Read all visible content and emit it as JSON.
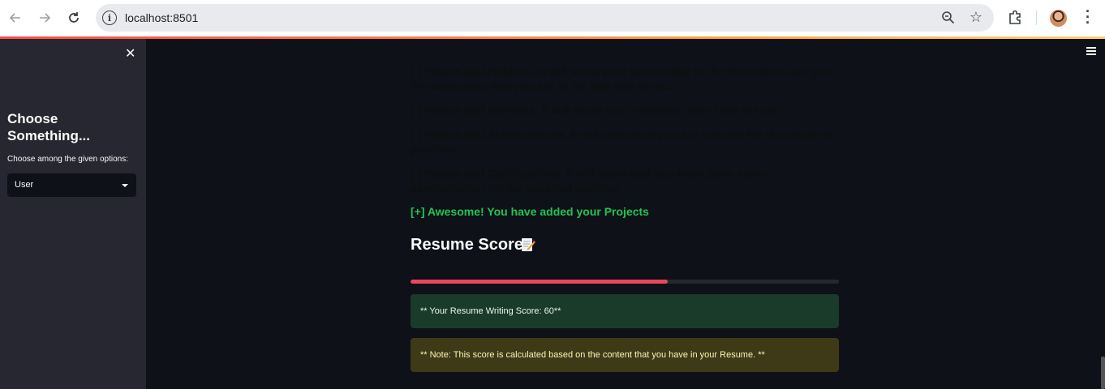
{
  "browser": {
    "url": "localhost:8501",
    "icons": [
      "back-icon",
      "forward-icon",
      "reload-icon",
      "info-icon",
      "zoom-icon",
      "star-icon",
      "extensions-icon",
      "profile-avatar",
      "menu-icon"
    ]
  },
  "sidebar": {
    "title": "Choose Something...",
    "select_label": "Choose among the given options:",
    "select_value": "User"
  },
  "main": {
    "tips": [
      "[-] Please add Hobbies. It will show your personality to the Recruiters and give the assurance that you are fit for this role or not.",
      "[-] Please add Interests. It will show your interests other than the job.",
      "[-] Please add Achievements. It will show that you are capable for the required position.",
      "[-] Please add Certifications. It will show that you have done some specialization for the required position."
    ],
    "projects_ok": "[+] Awesome! You have added your Projects",
    "score_heading": "Resume Score",
    "score_progress_percent": 60,
    "success_message": "** Your Resume Writing Score: 60**",
    "warning_message": "** Note: This score is calculated based on the content that you have in your Resume. **"
  },
  "colors": {
    "background": "#0e1117",
    "sidebar": "#262730",
    "primary": "#ff4b4b",
    "success_text": "#21c354"
  }
}
